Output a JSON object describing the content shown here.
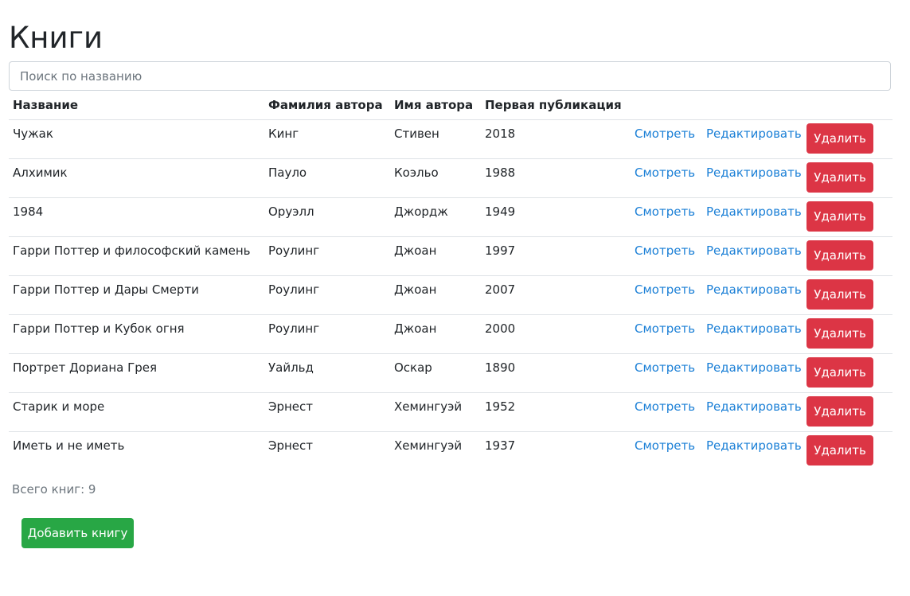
{
  "page": {
    "title": "Книги"
  },
  "search": {
    "placeholder": "Поиск по названию",
    "value": ""
  },
  "table": {
    "headers": [
      "Название",
      "Фамилия автора",
      "Имя автора",
      "Первая публикация",
      "",
      ""
    ],
    "rows": [
      {
        "title": "Чужак",
        "last_name": "Кинг",
        "first_name": "Стивен",
        "year": "2018",
        "view": "Смотреть",
        "edit": "Редактировать",
        "delete": "Удалить"
      },
      {
        "title": "Алхимик",
        "last_name": "Пауло",
        "first_name": "Коэльо",
        "year": "1988",
        "view": "Смотреть",
        "edit": "Редактировать",
        "delete": "Удалить"
      },
      {
        "title": "1984",
        "last_name": "Оруэлл",
        "first_name": "Джордж",
        "year": "1949",
        "view": "Смотреть",
        "edit": "Редактировать",
        "delete": "Удалить"
      },
      {
        "title": "Гарри Поттер и философский камень",
        "last_name": "Роулинг",
        "first_name": "Джоан",
        "year": "1997",
        "view": "Смотреть",
        "edit": "Редактировать",
        "delete": "Удалить"
      },
      {
        "title": "Гарри Поттер и Дары Смерти",
        "last_name": "Роулинг",
        "first_name": "Джоан",
        "year": "2007",
        "view": "Смотреть",
        "edit": "Редактировать",
        "delete": "Удалить"
      },
      {
        "title": "Гарри Поттер и Кубок огня",
        "last_name": "Роулинг",
        "first_name": "Джоан",
        "year": "2000",
        "view": "Смотреть",
        "edit": "Редактировать",
        "delete": "Удалить"
      },
      {
        "title": "Портрет Дориана Грея",
        "last_name": "Уайльд",
        "first_name": "Оскар",
        "year": "1890",
        "view": "Смотреть",
        "edit": "Редактировать",
        "delete": "Удалить"
      },
      {
        "title": "Старик и море",
        "last_name": "Эрнест",
        "first_name": "Хемингуэй",
        "year": "1952",
        "view": "Смотреть",
        "edit": "Редактировать",
        "delete": "Удалить"
      },
      {
        "title": "Иметь и не иметь",
        "last_name": "Эрнест",
        "first_name": "Хемингуэй",
        "year": "1937",
        "view": "Смотреть",
        "edit": "Редактировать",
        "delete": "Удалить"
      }
    ]
  },
  "footer": {
    "total_label": "Всего книг: 9",
    "add_button": "Добавить книгу"
  },
  "colors": {
    "link": "#1a7fd6",
    "danger": "#dc3545",
    "success": "#28a745",
    "muted": "#6c757d",
    "border": "#dee2e6"
  }
}
